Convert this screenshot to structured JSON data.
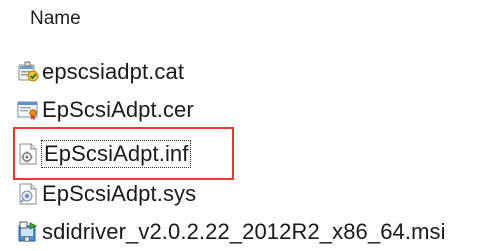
{
  "header": {
    "column_name": "Name"
  },
  "files": [
    {
      "name": "epscsiadpt.cat",
      "icon": "security-catalog-icon"
    },
    {
      "name": "EpScsiAdpt.cer",
      "icon": "certificate-icon"
    },
    {
      "name": "EpScsiAdpt.inf",
      "icon": "setup-information-icon",
      "selected": true,
      "highlighted": true
    },
    {
      "name": "EpScsiAdpt.sys",
      "icon": "system-file-icon"
    },
    {
      "name": "sdidriver_v2.0.2.22_2012R2_x86_64.msi",
      "icon": "windows-installer-icon"
    }
  ],
  "colors": {
    "highlight_border": "#e53935"
  }
}
